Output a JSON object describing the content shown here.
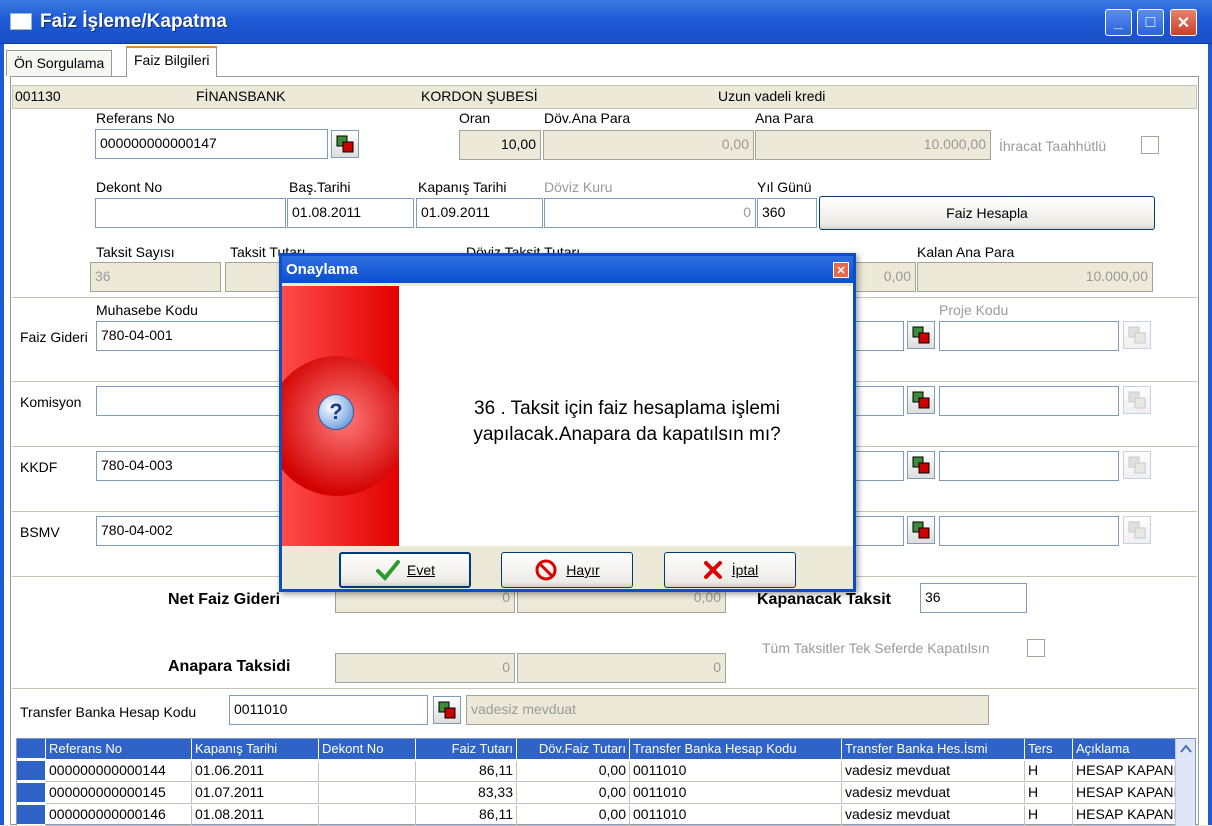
{
  "window": {
    "title": "Faiz İşleme/Kapatma",
    "min": "_",
    "max": "□",
    "close": "✕"
  },
  "tabs": [
    {
      "label": "Ön Sorgulama"
    },
    {
      "label": "Faiz Bilgileri"
    }
  ],
  "info": {
    "code": "001130",
    "bank": "FİNANSBANK",
    "branch": "KORDON ŞUBESİ",
    "type": "Uzun vadeli kredi"
  },
  "form": {
    "referans_no": {
      "label": "Referans No",
      "value": "000000000000147"
    },
    "oran": {
      "label": "Oran",
      "value": "10,00"
    },
    "dov_ana_para": {
      "label": "Döv.Ana Para",
      "value": "0,00"
    },
    "ana_para": {
      "label": "Ana Para",
      "value": "10.000,00"
    },
    "ihracat": {
      "label": "İhracat Taahhütlü"
    },
    "dekont_no": {
      "label": "Dekont No",
      "value": ""
    },
    "bas_tarihi": {
      "label": "Baş.Tarihi",
      "value": "01.08.2011"
    },
    "kapanis_tarihi": {
      "label": "Kapanış Tarihi",
      "value": "01.09.2011"
    },
    "doviz_kuru": {
      "label": "Döviz Kuru",
      "value": "0"
    },
    "yil_gunu": {
      "label": "Yıl Günü",
      "value": "360"
    },
    "faiz_hesapla": "Faiz Hesapla",
    "taksit_sayisi": {
      "label": "Taksit Sayısı",
      "value": "36"
    },
    "taksit_tutari": {
      "label": "Taksit Tutarı"
    },
    "doviz_taksit_tutari": {
      "label": "Döviz Taksit Tutarı"
    },
    "doviz_kalan": {
      "value": "0,00"
    },
    "kalan_ana_para": {
      "label": "Kalan Ana Para",
      "value": "10.000,00"
    },
    "muhasebe_kodu": "Muhasebe Kodu",
    "proje_kodu": "Proje Kodu",
    "rows": [
      {
        "label": "Faiz Gideri",
        "value": "780-04-001"
      },
      {
        "label": "Komisyon",
        "value": ""
      },
      {
        "label": "KKDF",
        "value": "780-04-003"
      },
      {
        "label": "BSMV",
        "value": "780-04-002"
      }
    ],
    "net_faiz_gideri": {
      "label": "Net Faiz Gideri",
      "v1": "0",
      "v2": "0,00"
    },
    "kapanacak_taksit": {
      "label": "Kapanacak Taksit",
      "value": "36"
    },
    "tum_taksitler": {
      "label": "Tüm Taksitler Tek Seferde Kapatılsın"
    },
    "anapara_taksidi": {
      "label": "Anapara Taksidi",
      "v1": "0",
      "v2": "0"
    },
    "transfer": {
      "label": "Transfer Banka Hesap Kodu",
      "value": "0011010",
      "desc": "vadesiz mevduat"
    }
  },
  "grid": {
    "headers": [
      "Referans No",
      "Kapanış Tarihi",
      "Dekont No",
      "Faiz Tutarı",
      "Döv.Faiz Tutarı",
      "Transfer Banka Hesap Kodu",
      "Transfer Banka Hes.İsmi",
      "Ters",
      "Açıklama"
    ],
    "rows": [
      [
        "000000000000144",
        "01.06.2011",
        "",
        "86,11",
        "0,00",
        "0011010",
        "vadesiz mevduat",
        "H",
        "HESAP KAPANIŞ"
      ],
      [
        "000000000000145",
        "01.07.2011",
        "",
        "83,33",
        "0,00",
        "0011010",
        "vadesiz mevduat",
        "H",
        "HESAP KAPANIŞ"
      ],
      [
        "000000000000146",
        "01.08.2011",
        "",
        "86,11",
        "0,00",
        "0011010",
        "vadesiz mevduat",
        "H",
        "HESAP KAPANIŞ"
      ]
    ]
  },
  "dialog": {
    "title": "Onaylama",
    "close": "✕",
    "icon": "?",
    "message_line1": "36 . Taksit için faiz hesaplama işlemi",
    "message_line2": "yapılacak.Anapara da kapatılsın mı?",
    "yes": "Evet",
    "no": "Hayır",
    "cancel": "İptal"
  },
  "colors": {
    "titlebar": "#1e5ad6",
    "dialog_red": "#e20000",
    "grid_header": "#2f63c8"
  }
}
